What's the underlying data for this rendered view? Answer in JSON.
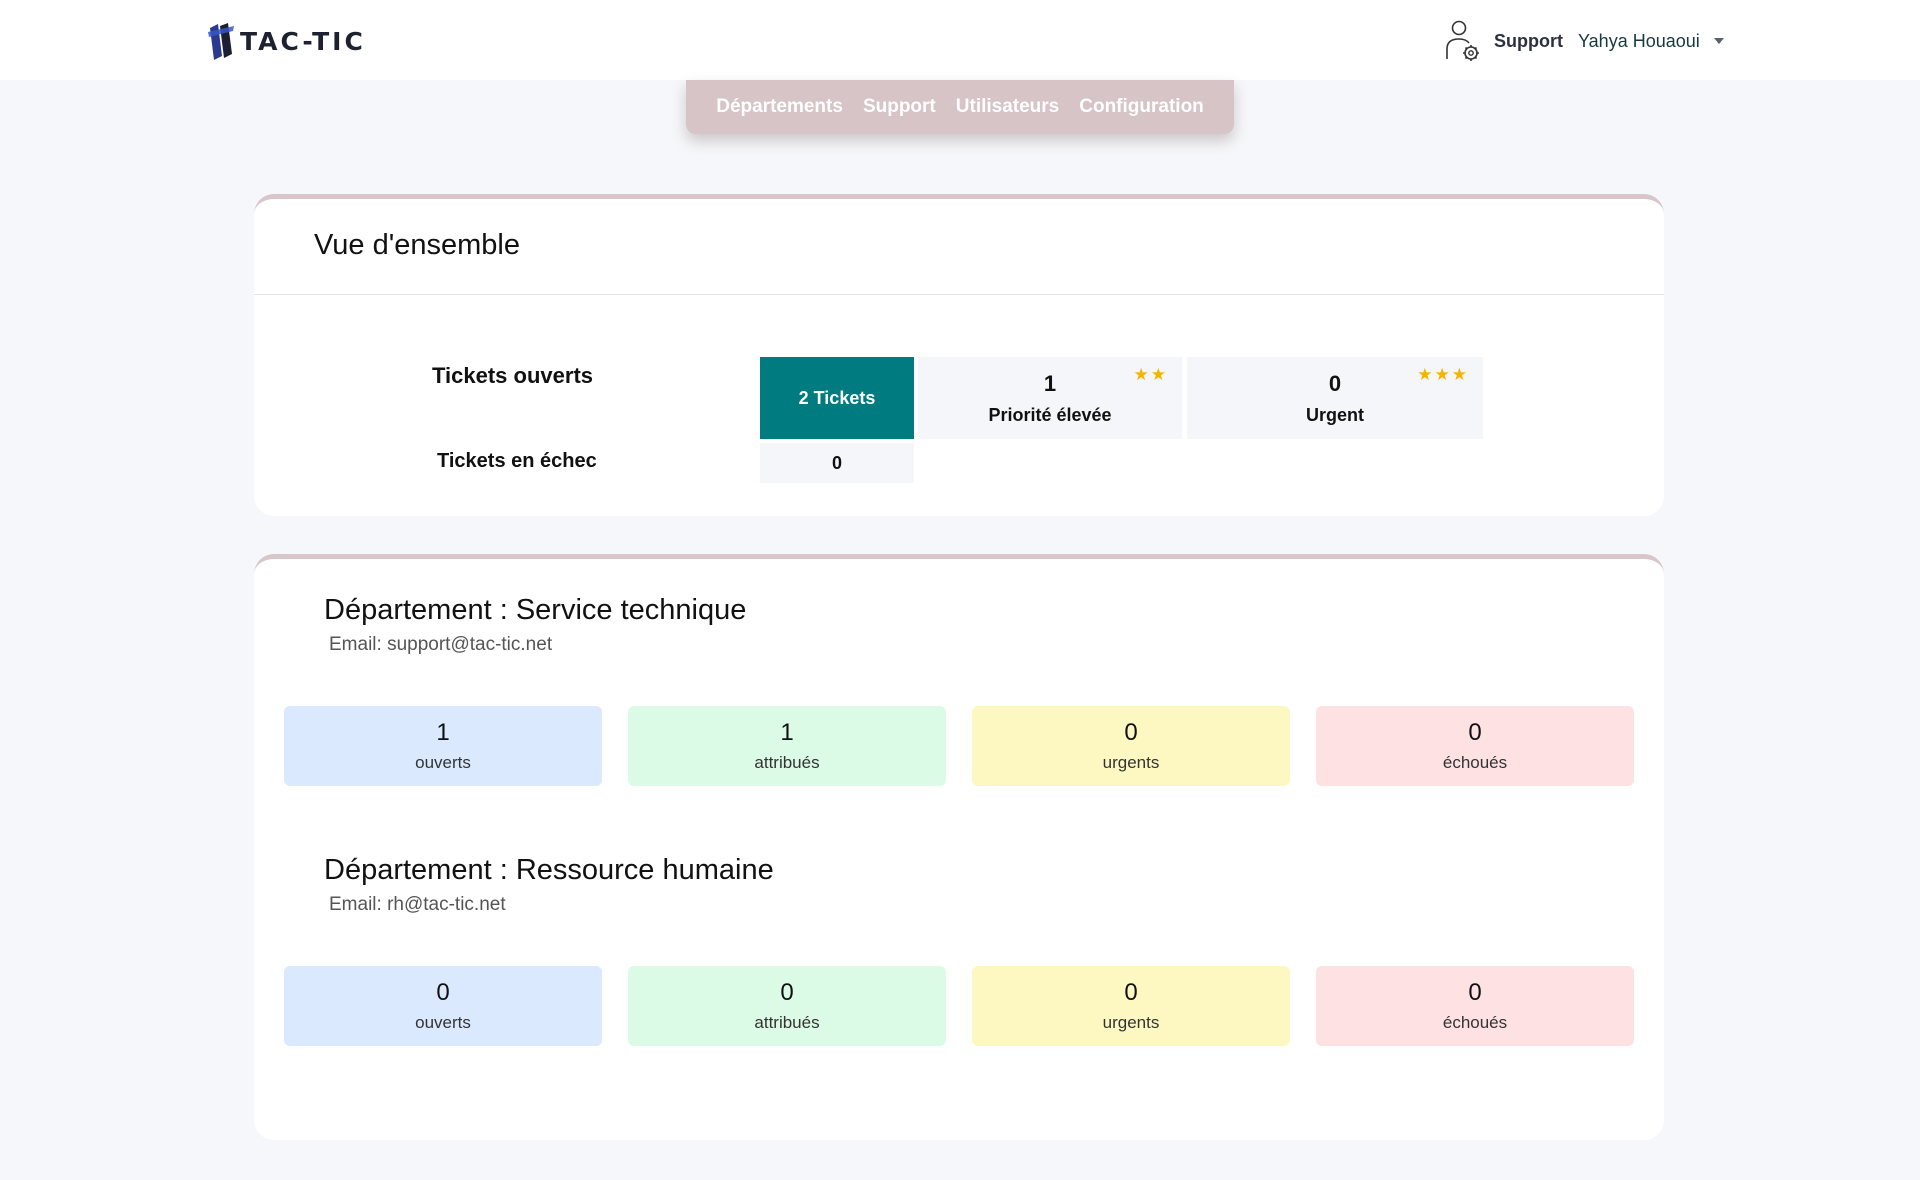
{
  "brand": {
    "name": "TAC-TIC"
  },
  "header": {
    "role": "Support",
    "user_name": "Yahya Houaoui"
  },
  "nav": {
    "items": [
      "Départements",
      "Support",
      "Utilisateurs",
      "Configuration"
    ]
  },
  "overview": {
    "title": "Vue d'ensemble",
    "open_label": "Tickets ouverts",
    "open_total": "2 Tickets",
    "high_priority": {
      "count": "1",
      "label": "Priorité élevée",
      "stars": "★★"
    },
    "urgent": {
      "count": "0",
      "label": "Urgent",
      "stars": "★★★"
    },
    "failed_label": "Tickets en échec",
    "failed_count": "0"
  },
  "departments": [
    {
      "title": "Département : Service technique",
      "email": "Email: support@tac-tic.net",
      "stats": [
        {
          "value": "1",
          "label": "ouverts"
        },
        {
          "value": "1",
          "label": "attribués"
        },
        {
          "value": "0",
          "label": "urgents"
        },
        {
          "value": "0",
          "label": "échoués"
        }
      ]
    },
    {
      "title": "Département : Ressource humaine",
      "email": "Email: rh@tac-tic.net",
      "stats": [
        {
          "value": "0",
          "label": "ouverts"
        },
        {
          "value": "0",
          "label": "attribués"
        },
        {
          "value": "0",
          "label": "urgents"
        },
        {
          "value": "0",
          "label": "échoués"
        }
      ]
    }
  ],
  "colors": {
    "teal": "#007c80",
    "nav_bg": "#d6c4c6",
    "star": "#f5b400",
    "stat_open": "#dbe9fe",
    "stat_assigned": "#dcfbe6",
    "stat_urgent": "#fdf8c2",
    "stat_failed": "#fde1e3"
  },
  "icons": {
    "logo": "tactic-logo-icon",
    "user": "user-gear-icon",
    "caret": "chevron-down-icon"
  }
}
